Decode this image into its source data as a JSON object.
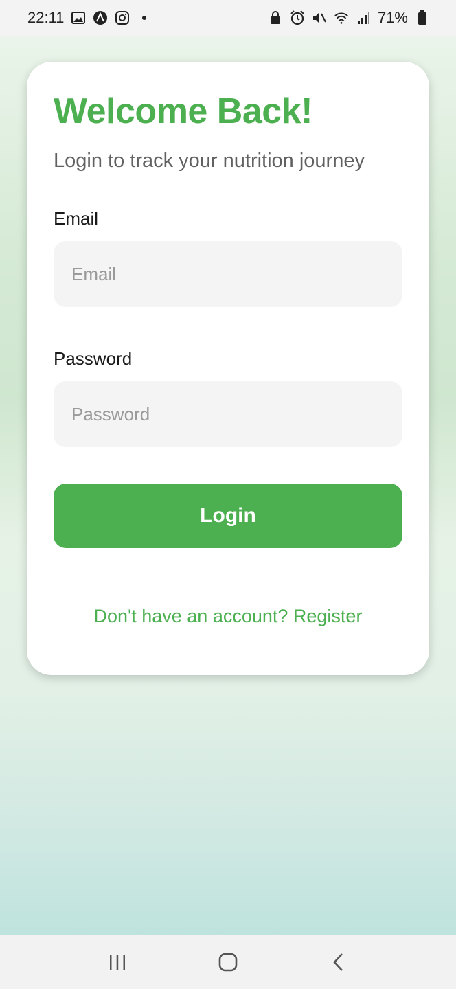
{
  "status_bar": {
    "time": "22:11",
    "left_icons": [
      "gallery-icon",
      "a-app-icon",
      "instagram-icon",
      "notification-dot"
    ],
    "right_icons": [
      "lock-icon",
      "alarm-icon",
      "mute-icon",
      "wifi-icon",
      "signal-icon",
      "battery-icon"
    ],
    "battery_percent": "71%"
  },
  "login": {
    "title": "Welcome Back!",
    "subtitle": "Login to track your nutrition journey",
    "email_label": "Email",
    "email_placeholder": "Email",
    "email_value": "",
    "password_label": "Password",
    "password_placeholder": "Password",
    "password_value": "",
    "login_button": "Login",
    "register_link": "Don't have an account? Register"
  },
  "colors": {
    "accent": "#4caf50",
    "card": "#ffffff",
    "input_bg": "#f4f4f4"
  },
  "nav_bar": {
    "buttons": [
      "recent-apps-icon",
      "home-icon",
      "back-icon"
    ]
  }
}
